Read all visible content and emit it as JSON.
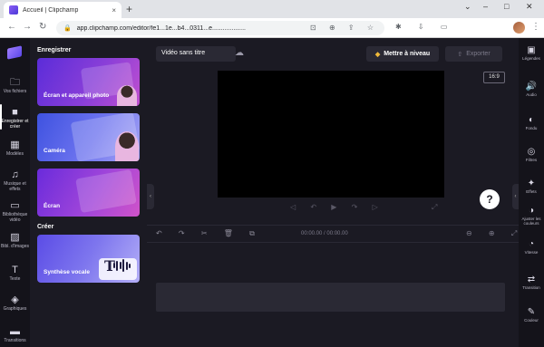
{
  "browser": {
    "tab_title": "Accueil | Clipchamp",
    "tab_close": "×",
    "new_tab": "+",
    "window_controls": [
      "⌄",
      "–",
      "□",
      "✕"
    ],
    "nav": {
      "back": "←",
      "forward": "→",
      "reload": "↻"
    },
    "url": "app.clipchamp.com/editor/fe1...1e...b4...0311...e...................",
    "omni_icons": "⊡ ⊕ ⇪ ☆",
    "ext_icons": "✱ ⇩ ▭",
    "menu": "⋮"
  },
  "leftnav": {
    "items": [
      {
        "icon": "🗀",
        "label": "Vos fichiers"
      },
      {
        "icon": "■",
        "label": "Enregistrer et créer"
      },
      {
        "icon": "▦",
        "label": "Modèles"
      },
      {
        "icon": "♫",
        "label": "Musique et effets"
      },
      {
        "icon": "▭",
        "label": "Bibliothèque vidéo"
      },
      {
        "icon": "▨",
        "label": "Bibl. d'images"
      },
      {
        "icon": "T",
        "label": "Texte"
      },
      {
        "icon": "◈",
        "label": "Graphiques"
      },
      {
        "icon": "▬",
        "label": "Transitions"
      }
    ]
  },
  "panel": {
    "record_title": "Enregistrer",
    "create_title": "Créer",
    "cards": [
      {
        "label": "Écran et appareil photo"
      },
      {
        "label": "Caméra"
      },
      {
        "label": "Écran"
      },
      {
        "label": "Synthèse vocale"
      }
    ],
    "tts_glyph": "T"
  },
  "topbar": {
    "project_title": "Vidéo sans titre",
    "upgrade_label": "Mettre à niveau",
    "upgrade_icon": "◆",
    "export_label": "Exporter",
    "export_icon": "⇧",
    "cloud_icon": "☁"
  },
  "preview": {
    "aspect_ratio": "16:9",
    "controls": "◁ ↶ ▶ ↷ ▷",
    "fullscreen": "⤢",
    "help": "?"
  },
  "timeline": {
    "tools": "↶ ↷ ✂ 🗑 ⧉",
    "time": "00:00.00 / 00:00.00",
    "zoom": "⊖ ⊕ ⤢"
  },
  "rightnav": {
    "items": [
      {
        "icon": "▣",
        "label": "Légendes"
      },
      {
        "icon": "🔊",
        "label": "Audio"
      },
      {
        "icon": "◐",
        "label": "Fondu"
      },
      {
        "icon": "◎",
        "label": "Filtres"
      },
      {
        "icon": "✦",
        "label": "Effets"
      },
      {
        "icon": "◑",
        "label": "Ajuster les couleurs"
      },
      {
        "icon": "◔",
        "label": "Vitesse"
      },
      {
        "icon": "⇄",
        "label": "Transition"
      },
      {
        "icon": "✎",
        "label": "Couleur"
      }
    ]
  },
  "colors": {
    "app_bg": "#1b1a23",
    "nav_bg": "#14131a",
    "accent": "#7b5cf0",
    "gem": "#f0b93a"
  }
}
